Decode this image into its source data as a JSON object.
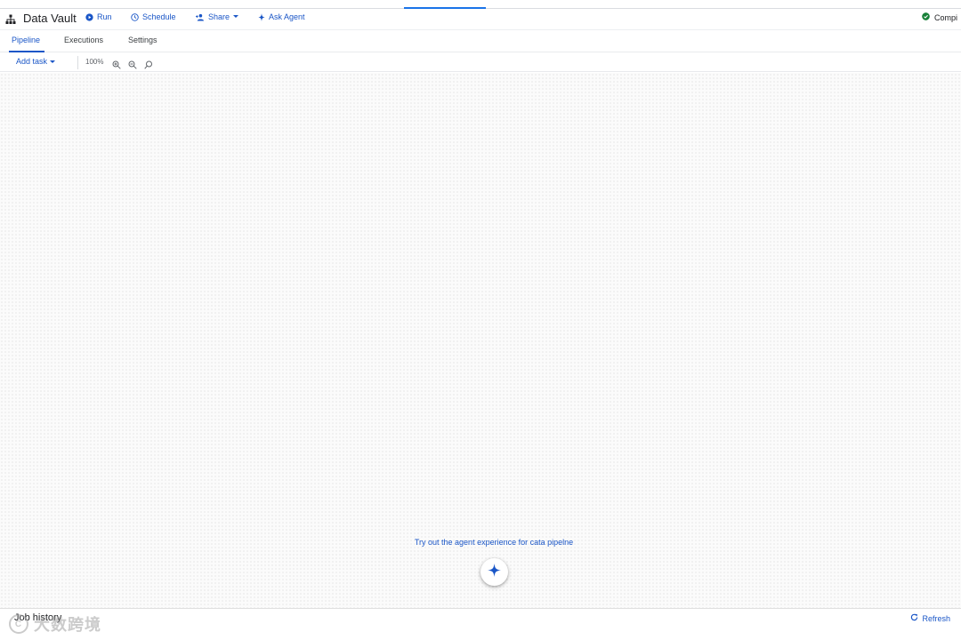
{
  "header": {
    "title": "Data Vault",
    "run_label": "Run",
    "schedule_label": "Schedule",
    "share_label": "Share",
    "ask_agent_label": "Ask Agent",
    "status_label": "Compi"
  },
  "tabs": [
    {
      "label": "Pipeline",
      "active": true
    },
    {
      "label": "Executions",
      "active": false
    },
    {
      "label": "Settings",
      "active": false
    }
  ],
  "toolbar": {
    "add_task_label": "Add task",
    "zoom_level": "100%"
  },
  "canvas": {
    "agent_hint": "Try out the agent experience for cata pipelne"
  },
  "footer": {
    "job_history_label": "Job history",
    "refresh_label": "Refresh"
  },
  "watermark": {
    "text": "大数跨境"
  },
  "colors": {
    "accent": "#1a56c7",
    "status_ok": "#188038"
  },
  "icons": [
    "pipeline-icon",
    "run-icon",
    "schedule-icon",
    "share-icon",
    "ask-agent-icon",
    "check-circle-icon",
    "caret-down-icon",
    "zoom-in-icon",
    "zoom-out-icon",
    "zoom-reset-icon",
    "sparkle-icon",
    "refresh-icon"
  ]
}
